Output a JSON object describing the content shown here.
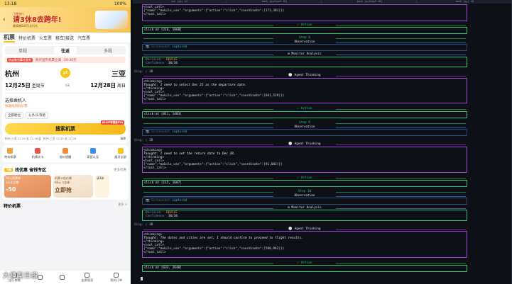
{
  "phone": {
    "status": {
      "time": "13:18",
      "battery": "100%"
    },
    "banner": {
      "tag": "飞猪旅行",
      "main": "请3休8去跨年!",
      "sub": "最高赠200元出行礼"
    },
    "main_tabs": [
      "机票",
      "特价机票",
      "火车票",
      "租车|接送",
      "汽车票"
    ],
    "trip_types": [
      "单程",
      "往返",
      "多程"
    ],
    "promo": {
      "hot": "热@聚划算优惠券",
      "text": "购买国内机票立减",
      "amount": "20-30元"
    },
    "from_city": "杭州",
    "to_city": "三亚",
    "depart_date": "12月25日",
    "depart_day": "圣诞节",
    "duration": "4天",
    "return_date": "12月28日",
    "return_day": "周日",
    "passenger_title": "选择乘机人",
    "passenger_sub": "快速找到低价票",
    "chips": [
      "全部舱位",
      "公务/头等舱"
    ],
    "search_label": "搜索机票",
    "search_tag": "89VIP享最高¥10",
    "history": [
      "杭州-三亚 12-25 去 12-28 返",
      "杭州-三亚 12-25 去 12-28"
    ],
    "history_clear": "清除",
    "quick": [
      {
        "label": "特价机票",
        "color": "#f0a33b"
      },
      {
        "label": "机票次卡",
        "color": "#e8584a"
      },
      {
        "label": "低价提醒",
        "color": "#f08c3b"
      },
      {
        "label": "家庭认证",
        "color": "#3b8ff0"
      },
      {
        "label": "展开全部",
        "color": "#f5c518"
      }
    ],
    "special": {
      "logo": "飞猪",
      "title": "找优惠 省钱专区",
      "more": "更多优惠"
    },
    "cards": [
      {
        "title": "50元机票券",
        "sub": "3天后过期",
        "big": "-50"
      },
      {
        "title": "机票卡低价圈",
        "sub": "66元飞全球",
        "big": "立即抢"
      },
      {
        "title": "请3休",
        "sub": "",
        "big": ""
      }
    ],
    "low_title": "特价机票",
    "low_more": "更多 >",
    "nav": [
      "出行攻略",
      "",
      "",
      "出票管家",
      "我的订单"
    ],
    "watermark": "大模型日报"
  },
  "terminal": {
    "tabs": [
      "zsh (py)  ⌘1",
      "bash (python3.10)",
      "bash (python3.10)",
      "bash (py)  ⌘5"
    ],
    "lines": {
      "l0": "<tool_call>",
      "l1": "{\"name\":\"mobile_use\",\"arguments\":{\"action\":\"click\",\"coordinate\":[171,381]}}",
      "l2": "</tool_call>",
      "a1": "✓ Action",
      "c1": "click at (216, 1068)",
      "s8": "Step 8",
      "obs1": "Observation",
      "scr1": "Screenshot",
      "cap1": "captured",
      "ma1": "Monitor Analysis",
      "dec1_k": "Decision",
      "dec1_v": "DEVICE",
      "conf1_k": "Confidence",
      "conf1_v": "10/10",
      "g1": "Qing:",
      "g1v": "2B",
      "at1": "Agent Thinking",
      "t1a": "<thinking>",
      "t1b": "Thought: I need to select Dec 25 as the departure date.",
      "t1c": "</thinking>",
      "t1d": "<tool_call>",
      "t1e": "{\"name\":\"mobile_use\",\"arguments\":{\"action\":\"click\",\"coordinate\":[641,529]}}",
      "t1f": "</tool_call>",
      "a2": "✓ Action",
      "c2": "click at (811, 1483)",
      "s9": "Step 9",
      "obs2": "Observation",
      "scr2": "Screenshot",
      "cap2": "captured",
      "g2": "Qing:",
      "g2v": "2B",
      "at2": "Agent Thinking",
      "t2a": "<thinking>",
      "t2b": "Thought: I need to set the return date to Dec 28.",
      "t2c": "</thinking>",
      "t2d": "<tool_call>",
      "t2e": "{\"name\":\"mobile_use\",\"arguments\":{\"action\":\"click\",\"coordinate\":[91,602]}}",
      "t2f": "</tool_call>",
      "a3": "✓ Action",
      "c3": "click at (115, 1687)",
      "s10": "Step 10",
      "obs3": "Observation",
      "scr3": "Screenshot",
      "cap3": "captured",
      "ma2": "Monitor Analysis",
      "dec2_k": "Decision",
      "dec2_v": "DEVICE",
      "conf2_k": "Confidence",
      "conf2_v": "10/10",
      "g3": "Qing:",
      "g3v": "2B",
      "at3": "Agent Thinking",
      "t3a": "<thinking>",
      "t3b": "Thought: The dates and cities are set; I should confirm to proceed to flight results.",
      "t3c": "</thinking>",
      "t3d": "<tool_call>",
      "t3e": "{\"name\":\"mobile_use\",\"arguments\":{\"action\":\"click\",\"coordinate\":[500,942]}}",
      "t3f": "</tool_call>",
      "a4": "✓ Action",
      "c4": "click at (633, 2640)"
    }
  },
  "colors": {
    "green": "#33c26a",
    "blue": "#3a7bd5",
    "purple": "#a14ad8",
    "brand_yellow": "#f5c518"
  }
}
